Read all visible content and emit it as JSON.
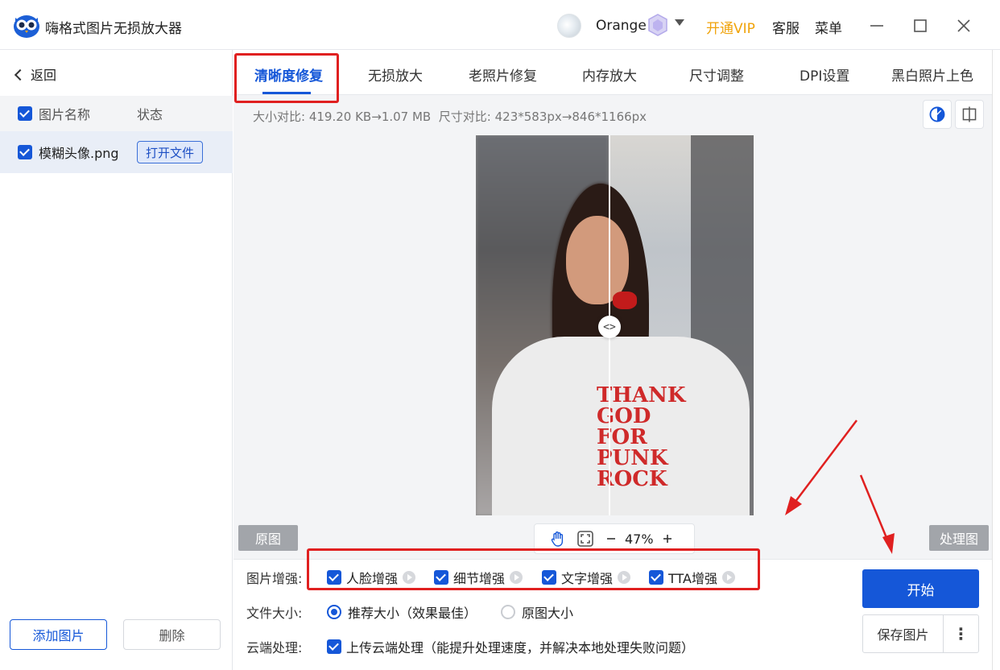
{
  "app": {
    "title": "嗨格式图片无损放大器",
    "username": "Orange",
    "vip": "开通VIP",
    "support": "客服",
    "menu": "菜单",
    "colors": {
      "accent": "#1557d8",
      "vip": "#f0a30a",
      "highlight": "#e02020"
    }
  },
  "sidebar": {
    "back": "返回",
    "col_name": "图片名称",
    "col_status": "状态",
    "files": [
      {
        "name": "模糊头像.png",
        "action": "打开文件"
      }
    ],
    "add": "添加图片",
    "delete": "删除"
  },
  "tabs": [
    {
      "label": "清晰度修复",
      "active": true
    },
    {
      "label": "无损放大",
      "active": false
    },
    {
      "label": "老照片修复",
      "active": false
    },
    {
      "label": "内存放大",
      "active": false
    },
    {
      "label": "尺寸调整",
      "active": false
    },
    {
      "label": "DPI设置",
      "active": false
    },
    {
      "label": "黑白照片上色",
      "active": false
    }
  ],
  "compare": {
    "size_label": "大小对比:",
    "size_from": "419.20 KB",
    "size_to": "1.07 MB",
    "dim_label": "尺寸对比:",
    "dim_from": "423*583px",
    "dim_to": "846*1166px",
    "arrow": "→"
  },
  "preview": {
    "original": "原图",
    "processed": "处理图",
    "zoom": "47%",
    "shirt_text": "THANK GOD FOR PUNK ROCK",
    "handle": "<>"
  },
  "options": {
    "enhance_label": "图片增强:",
    "enhance": [
      {
        "label": "人脸增强",
        "checked": true
      },
      {
        "label": "细节增强",
        "checked": true
      },
      {
        "label": "文字增强",
        "checked": true
      },
      {
        "label": "TTA增强",
        "checked": true
      }
    ],
    "size_label": "文件大小:",
    "size_options": [
      {
        "label": "推荐大小（效果最佳）",
        "selected": true
      },
      {
        "label": "原图大小",
        "selected": false
      }
    ],
    "cloud_label": "云端处理:",
    "cloud_option": "上传云端处理（能提升处理速度，并解决本地处理失败问题）",
    "start": "开始",
    "save": "保存图片",
    "more": "⋮"
  }
}
